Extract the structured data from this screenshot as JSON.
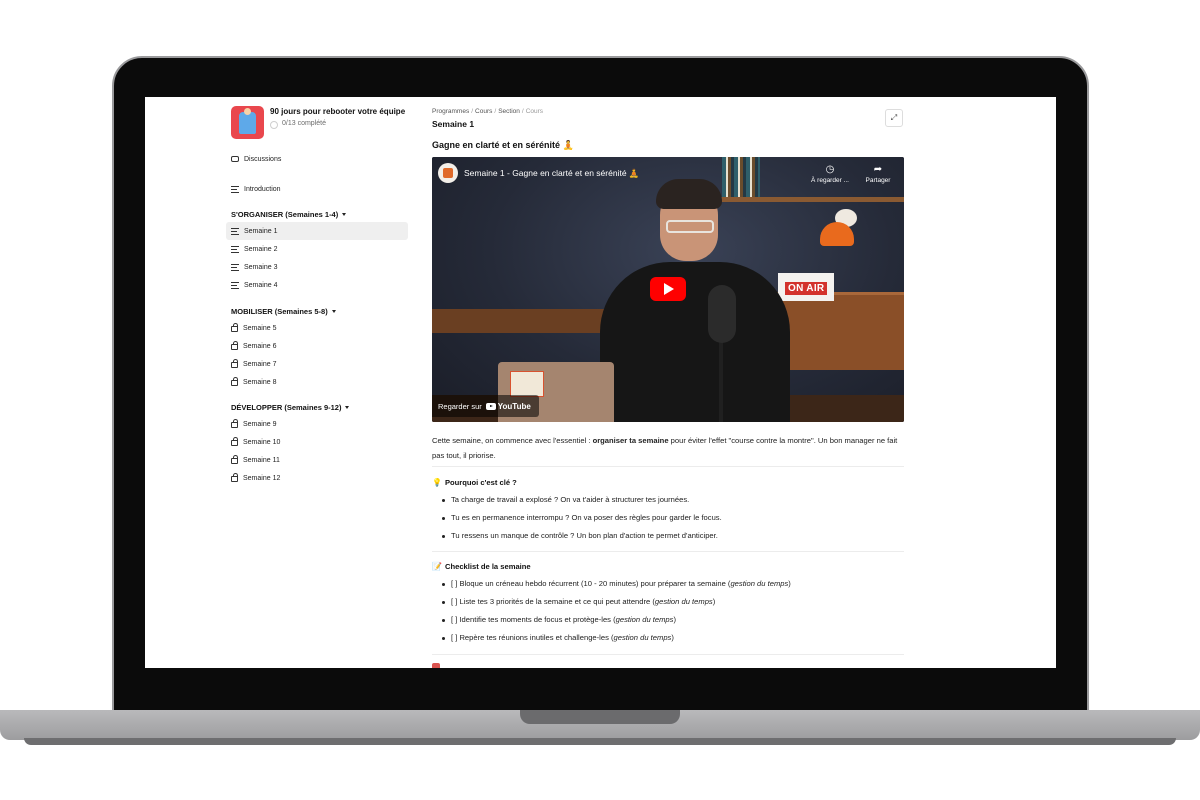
{
  "course": {
    "title": "90 jours pour rebooter votre équipe",
    "progress": "0/13 complété"
  },
  "sidebar": {
    "discussions": "Discussions",
    "introduction": "Introduction",
    "sections": [
      {
        "title": "S'ORGANISER (Semaines 1-4)",
        "items": [
          "Semaine 1",
          "Semaine 2",
          "Semaine 3",
          "Semaine 4"
        ],
        "locked": false
      },
      {
        "title": "MOBILISER (Semaines 5-8)",
        "items": [
          "Semaine 5",
          "Semaine 6",
          "Semaine 7",
          "Semaine 8"
        ],
        "locked": true
      },
      {
        "title": "DÉVELOPPER (Semaines 9-12)",
        "items": [
          "Semaine 9",
          "Semaine 10",
          "Semaine 11",
          "Semaine 12"
        ],
        "locked": true
      }
    ],
    "active_item": "Semaine 1"
  },
  "breadcrumb": [
    "Programmes",
    "Cours",
    "Section",
    "Cours"
  ],
  "page_title": "Semaine 1",
  "lesson_title": "Gagne en clarté et en sérénité 🧘",
  "video": {
    "title": "Semaine 1 - Gagne en clarté et en sérénité 🧘",
    "watch_later": "À regarder ...",
    "share": "Partager",
    "watch_on": "Regarder sur",
    "platform": "YouTube",
    "sign_text": "ON AIR"
  },
  "intro": {
    "before": "Cette semaine, on commence avec l'essentiel : ",
    "bold": "organiser ta semaine",
    "after": " pour éviter l'effet \"course contre la montre\". Un bon manager ne fait pas tout, il priorise."
  },
  "why": {
    "emoji": "💡",
    "title": "Pourquoi c'est clé ?",
    "items": [
      "Ta charge de travail a explosé ? On va t'aider à structurer tes journées.",
      "Tu es en permanence interrompu ? On va poser des règles pour garder le focus.",
      "Tu ressens un manque de contrôle ? Un bon plan d'action te permet d'anticiper."
    ]
  },
  "checklist": {
    "emoji": "📝",
    "title": "Checklist de la semaine",
    "tag": "gestion du temps",
    "items": [
      "[ ] Bloque un créneau hebdo récurrent (10 - 20 minutes) pour préparer ta semaine",
      "[ ] Liste tes 3 priorités de la semaine et ce qui peut attendre",
      "[ ] Identifie tes moments de focus et protège-les",
      "[ ] Repère tes réunions inutiles et challenge-les"
    ]
  },
  "icons": {
    "discussions": "chat-icon",
    "lesson": "lines-icon",
    "locked": "lock-icon",
    "expand": "expand-icon",
    "watch_later": "clock-icon",
    "share": "share-icon",
    "play": "play-icon"
  },
  "colors": {
    "accent_red": "#ff0000",
    "thumbnail": "#e9474d",
    "active_bg": "#efefef"
  }
}
